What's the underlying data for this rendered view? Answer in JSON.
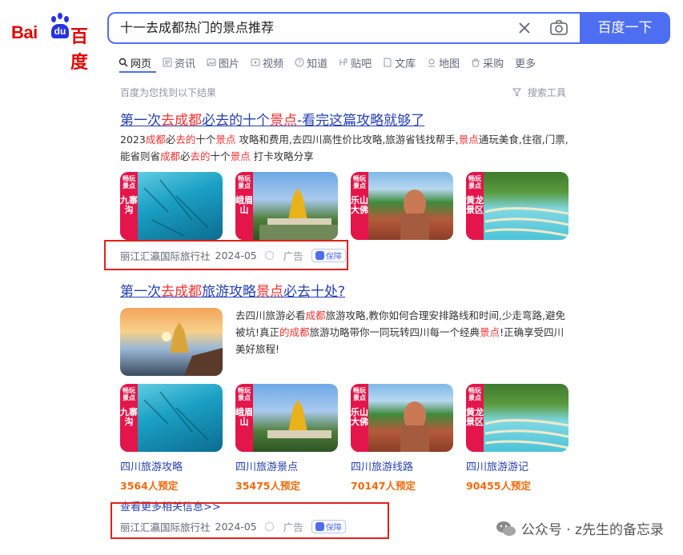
{
  "logo": {
    "text_left": "Bai",
    "text_mid": "du",
    "text_right": "百度"
  },
  "search": {
    "query": "十一去成都热门的景点推荐",
    "button_label": "百度一下"
  },
  "tabs": [
    {
      "label": "网页",
      "icon": "search-icon",
      "active": true
    },
    {
      "label": "资讯",
      "icon": "news-icon"
    },
    {
      "label": "图片",
      "icon": "image-icon"
    },
    {
      "label": "视频",
      "icon": "video-icon"
    },
    {
      "label": "知道",
      "icon": "question-icon"
    },
    {
      "label": "贴吧",
      "icon": "tieba-icon"
    },
    {
      "label": "文库",
      "icon": "doc-icon"
    },
    {
      "label": "地图",
      "icon": "map-icon"
    },
    {
      "label": "采购",
      "icon": "cart-icon"
    },
    {
      "label": "更多"
    }
  ],
  "found_text": "百度为您找到以下结果",
  "tools_label": "搜索工具",
  "result1": {
    "title_parts": [
      "第一次",
      "去成都",
      "必去的十个",
      "景点",
      "-看完这篇攻略就够了"
    ],
    "abstract_parts": [
      "2023",
      "成都",
      "必",
      "去的",
      "十个",
      "景点",
      " 攻略和费用,去四川高性价比攻略,旅游省钱找帮手,",
      "景点",
      "通玩美食,住宿,门票,能省则省",
      "成都",
      "必",
      "去的",
      "十个",
      "景点",
      " 打卡攻略分享"
    ],
    "thumbs": [
      {
        "tag_small": "畅玩景点",
        "tag": "九寨沟",
        "icon": "jiuzhaigou-photo"
      },
      {
        "tag_small": "畅玩景点",
        "tag": "峨眉山",
        "icon": "emeishan-photo"
      },
      {
        "tag_small": "畅玩景点",
        "tag": "乐山大佛",
        "icon": "leshan-photo"
      },
      {
        "tag_small": "畅玩景点",
        "tag": "黄龙景区",
        "icon": "huanglong-photo"
      }
    ],
    "source": "丽江汇瀛国际旅行社",
    "date": "2024-05",
    "ad_label": "广告",
    "guarantee_label": "保障"
  },
  "result2": {
    "title_parts": [
      "第一次",
      "去成都",
      "旅游攻略",
      "景点",
      "必去十处?"
    ],
    "abstract_parts": [
      "去四川旅游必看",
      "成都",
      "旅游攻略,教你如何合理安排路线和时间,少走弯路,避免被坑!真正",
      "的",
      "成都",
      "旅游功略带你一同玩转四川每一个经典",
      "景点",
      "!正确享受四川美好旅程!"
    ],
    "cards": [
      {
        "tag_small": "畅玩景点",
        "tag": "九寨沟",
        "caption": "四川旅游攻略",
        "booked": "3564人预定"
      },
      {
        "tag_small": "畅玩景点",
        "tag": "峨眉山",
        "caption": "四川旅游景点",
        "booked": "35475人预定"
      },
      {
        "tag_small": "畅玩景点",
        "tag": "乐山大佛",
        "caption": "四川旅游线路",
        "booked": "70147人预定"
      },
      {
        "tag_small": "畅玩景点",
        "tag": "黄龙景区",
        "caption": "四川旅游游记",
        "booked": "90455人预定"
      }
    ],
    "more_link": "查看更多相关信息>>",
    "source": "丽江汇瀛国际旅行社",
    "date": "2024-05",
    "ad_label": "广告",
    "guarantee_label": "保障"
  },
  "watermark": "公众号 · z先生的备忘录",
  "colors": {
    "brand_blue": "#4e6ef2",
    "link": "#2440b3",
    "highlight": "#f73131",
    "annotation_red": "#e3201a",
    "booked_orange": "#f4690b",
    "tag_red": "#e4154a"
  }
}
